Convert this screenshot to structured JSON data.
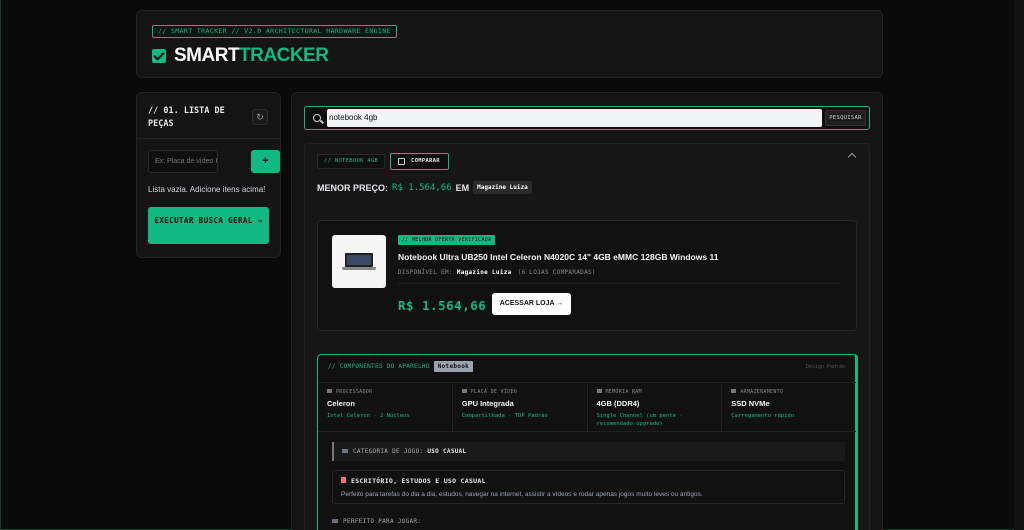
{
  "header": {
    "tagline": "// SMART TRACKER // V2.0 ARCHITECTURAL HARDWARE ENGINE",
    "brand_part1": "SMART",
    "brand_part2": "TRACKER"
  },
  "sidebar": {
    "title": "// 01. LISTA DE PEÇAS",
    "input_placeholder": "Ex: Placa de vídeo RX 66C",
    "add_label": "+",
    "empty_text": "Lista vazia. Adicione itens acima!",
    "run_label": "EXECUTAR BUSCA GERAL →"
  },
  "search": {
    "value": "notebook 4gb",
    "button_label": "PESQUISAR"
  },
  "result": {
    "query_tag": "// NOTEBOOK 4GB",
    "compare_label": "COMPARAR",
    "min_price_label": "MENOR PREÇO:",
    "min_price_value": "R$ 1.564,66",
    "min_price_em": "EM",
    "min_price_store": "Magazine Luiza"
  },
  "offer": {
    "badge": "// MELHOR OFERTA VERIFICADA",
    "title": "Notebook Ultra UB250 Intel Celeron N4020C 14\" 4GB eMMC 128GB Windows 11",
    "available_label": "DISPONÍVEL EM:",
    "store": "Magazine Luiza",
    "stores_compared": "(6 LOJAS COMPARADAS)",
    "price": "R$ 1.564,66",
    "visit_label": "ACESSAR LOJA →"
  },
  "components": {
    "header": "// COMPONENTES DO APARELHO",
    "type_chip": "Notebook",
    "standard_label": "Design Padrão",
    "specs": [
      {
        "label": "PROCESSADOR",
        "value": "Celeron",
        "sub": "Intel Celeron · 2 Núcleos"
      },
      {
        "label": "PLACA DE VÍDEO",
        "value": "GPU Integrada",
        "sub": "Compartilhada · TDP Padrão"
      },
      {
        "label": "MEMÓRIA RAM",
        "value": "4GB (DDR4)",
        "sub": "Single Channel (um pente · recomendado upgrade)"
      },
      {
        "label": "ARMAZENAMENTO",
        "value": "SSD NVMe",
        "sub": "Carregamento rápido"
      }
    ],
    "game_category_label": "CATEGORIA DE JOGO:",
    "game_category_value": "USO CASUAL",
    "office_title": "ESCRITÓRIO, ESTUDOS E USO CASUAL",
    "office_desc": "Perfeito para tarefas do dia a dia, estudos, navegar na internet, assistir a vídeos e rodar apenas jogos muito leves ou antigos.",
    "play_label": "PERFEITO PARA JOGAR:"
  }
}
